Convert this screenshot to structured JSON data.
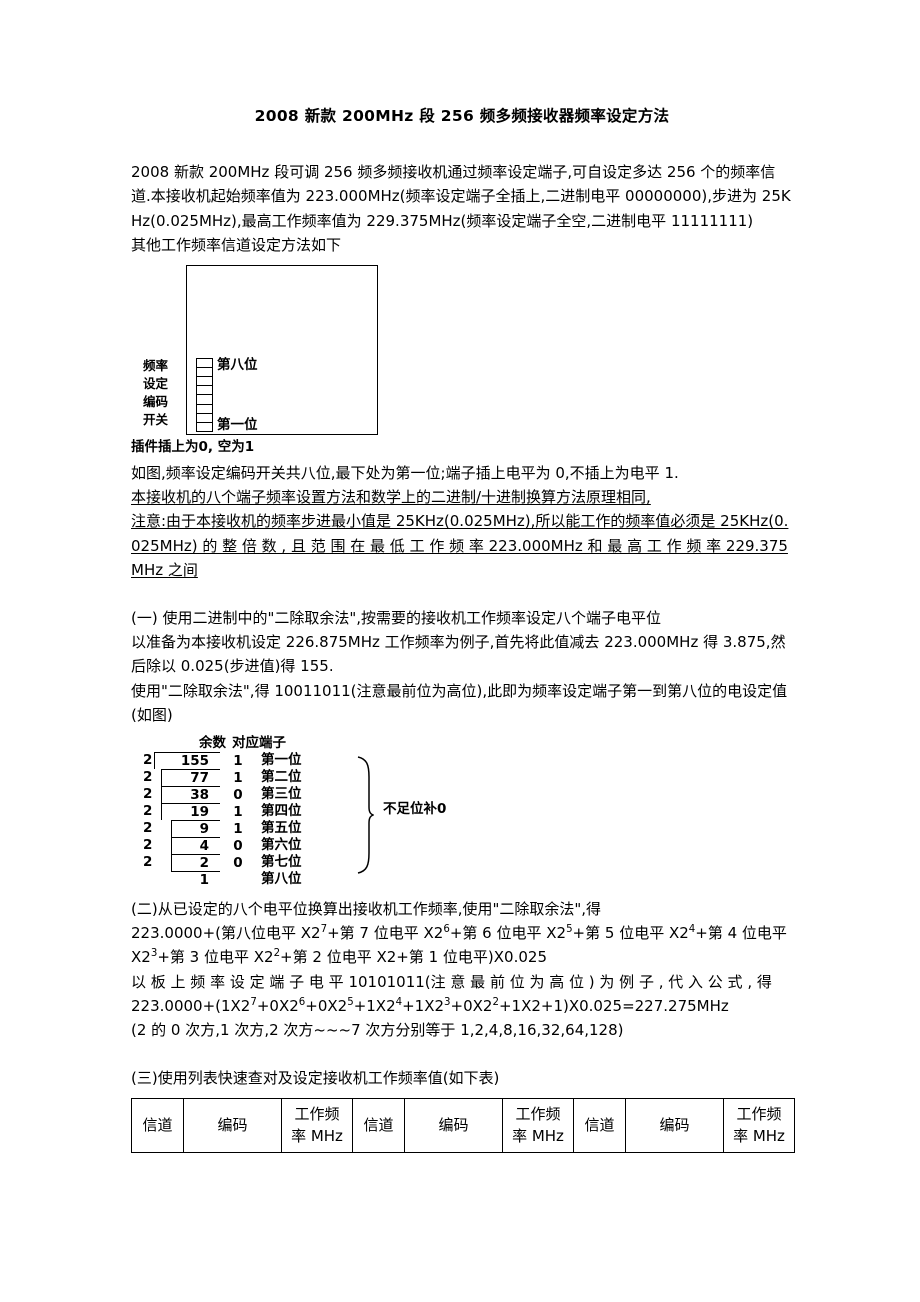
{
  "document": {
    "title": "2008 新款 200MHz 段 256 频多频接收器频率设定方法",
    "intro": "2008 新款 200MHz 段可调 256 频多频接收机通过频率设定端子,可自设定多达 256 个的频率信道.本接收机起始频率值为 223.000MHz(频率设定端子全插上,二进制电平 00000000),步进为 25KHz(0.025MHz),最高工作频率值为 229.375MHz(频率设定端子全空,二进制电平 11111111)",
    "intro_lead": "其他工作频率信道设定方法如下"
  },
  "switch_diagram": {
    "vertical_label_col1": [
      "频",
      "设",
      "编",
      "开"
    ],
    "vertical_label_col2": [
      "率",
      "定",
      "码",
      "关"
    ],
    "top_bit_label": "第八位",
    "bottom_bit_label": "第一位",
    "switch_count": 8,
    "caption": "插件插上为0, 空为1"
  },
  "notes": {
    "line1": "如图,频率设定编码开关共八位,最下处为第一位;端子插上电平为 0,不插上为电平 1.",
    "line2": "本接收机的八个端子频率设置方法和数学上的二进制/十进制换算方法原理相同,",
    "line3": "注意:由于本接收机的频率步进最小值是 25KHz(0.025MHz),所以能工作的频率值必须是 25KHz(0.025MHz) 的 整 倍 数 , 且 范 围 在 最 低 工 作 频 率 223.000MHz 和 最 高 工 作 频 率 229.375MHz 之间"
  },
  "section_one": {
    "heading": "(一) 使用二进制中的\"二除取余法\",按需要的接收机工作频率设定八个端子电平位",
    "body1": "以准备为本接收机设定 226.875MHz 工作频率为例子,首先将此值减去 223.000MHz 得 3.875,然后除以 0.025(步进值)得 155.",
    "body2": "使用\"二除取余法\",得 10011011(注意最前位为高位),此即为频率设定端子第一到第八位的电设定值(如图)"
  },
  "division_diagram": {
    "header_remainder": "余数",
    "header_terminal": "对应端子",
    "divisor": "2",
    "rows": [
      {
        "divisor": "2",
        "quotient": "155",
        "remainder": "1",
        "terminal": "第一位"
      },
      {
        "divisor": "2",
        "quotient": "77",
        "remainder": "1",
        "terminal": "第二位"
      },
      {
        "divisor": "2",
        "quotient": "38",
        "remainder": "0",
        "terminal": "第三位"
      },
      {
        "divisor": "2",
        "quotient": "19",
        "remainder": "1",
        "terminal": "第四位"
      },
      {
        "divisor": "2",
        "quotient": "9",
        "remainder": "1",
        "terminal": "第五位"
      },
      {
        "divisor": "2",
        "quotient": "4",
        "remainder": "0",
        "terminal": "第六位"
      },
      {
        "divisor": "2",
        "quotient": "2",
        "remainder": "0",
        "terminal": "第七位"
      },
      {
        "divisor": "",
        "quotient": "1",
        "remainder": "",
        "terminal": "第八位"
      }
    ],
    "brace_note": "不足位补0"
  },
  "section_two": {
    "heading": "(二)从已设定的八个电平位换算出接收机工作频率,使用\"二除取余法\",得",
    "formula_prefix": "223.0000+(第八位电平 X2",
    "formula_sup7": "7",
    "formula_p1": "+第 7 位电平 X2",
    "formula_sup6": "6",
    "formula_p2": "+第 6 位电平 X2",
    "formula_sup5": "5",
    "formula_p3": "+第 5 位电平 X2",
    "formula_sup4": "4",
    "formula_p4": "+第 4 位电平 X2",
    "formula_sup3": "3",
    "formula_p5": "+第 3 位电平 X2",
    "formula_sup2": "2",
    "formula_p6": "+第 2 位电平 X2+第 1 位电平)X0.025",
    "example_lead": "以 板 上 频 率 设 定 端 子 电 平 10101011(注 意 最 前 位 为 高 位 ) 为 例 子 , 代 入 公 式 , 得",
    "calc_prefix": "223.0000+(1X2",
    "calc_sup7": "7",
    "calc_c1": "+0X2",
    "calc_sup6": "6",
    "calc_c2": "+0X2",
    "calc_sup5": "5",
    "calc_c3": "+1X2",
    "calc_sup4": "4",
    "calc_c4": "+1X2",
    "calc_sup3": "3",
    "calc_c5": "+0X2",
    "calc_sup2": "2",
    "calc_c6": "+1X2+1)X0.025=227.275MHz",
    "powers_note": "(2 的 0 次方,1 次方,2 次方~~~7 次方分别等于 1,2,4,8,16,32,64,128)"
  },
  "section_three": {
    "heading": "(三)使用列表快速查对及设定接收机工作频率值(如下表)",
    "table_headers": {
      "channel": "信道",
      "code": "编码",
      "freq_line1": "工作频",
      "freq_line2": "率 MHz"
    }
  },
  "colors": {
    "text": "#000000",
    "background": "#ffffff",
    "border": "#000000"
  }
}
